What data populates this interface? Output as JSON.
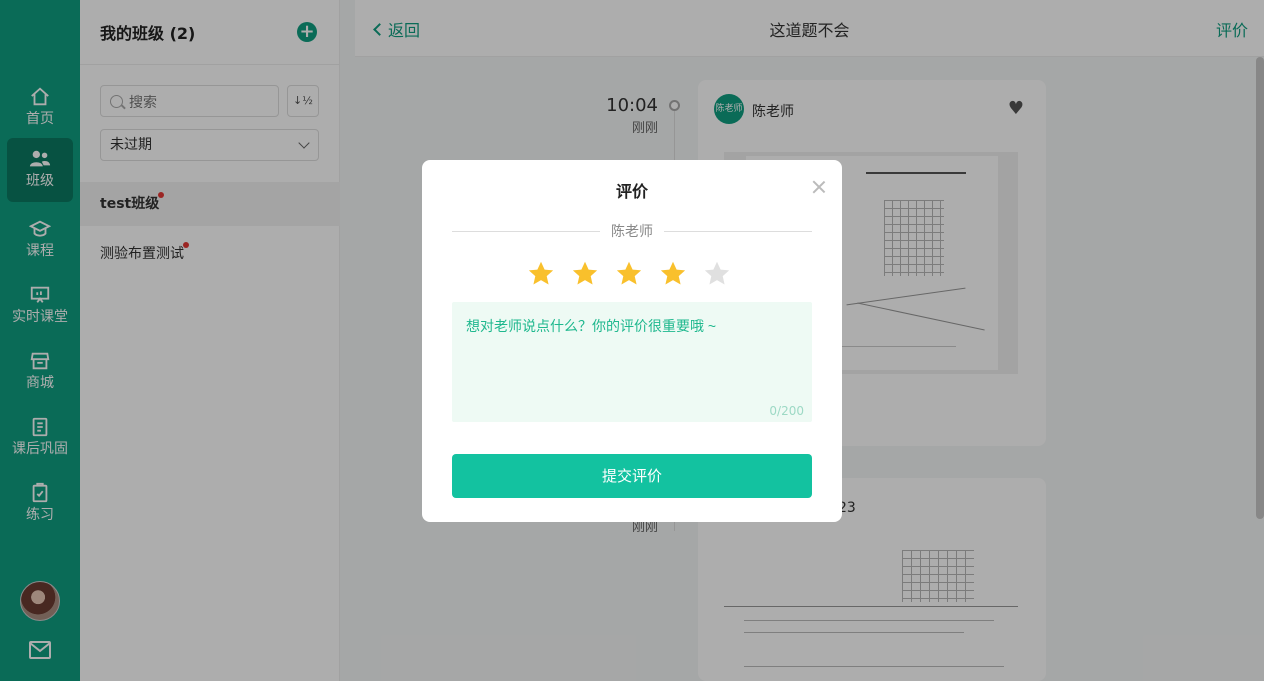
{
  "nav": {
    "items": [
      {
        "label": "首页",
        "icon": "home-icon"
      },
      {
        "label": "班级",
        "icon": "users-icon"
      },
      {
        "label": "课程",
        "icon": "graduation-cap-icon"
      },
      {
        "label": "实时课堂",
        "icon": "presentation-board-icon"
      },
      {
        "label": "商城",
        "icon": "store-icon"
      },
      {
        "label": "课后巩固",
        "icon": "notebook-icon"
      },
      {
        "label": "练习",
        "icon": "clipboard-check-icon"
      }
    ],
    "active_index": 1,
    "accent": "#0f9e80"
  },
  "class_panel": {
    "title": "我的班级 (2)",
    "search_placeholder": "搜索",
    "sort_label": "↓½",
    "filter_value": "未过期",
    "classes": [
      {
        "name": "test班级"
      },
      {
        "name": "测验布置测试"
      }
    ]
  },
  "topbar": {
    "back_label": "返回",
    "title": "这道题不会",
    "rate_label": "评价"
  },
  "timeline": {
    "time": "10:04",
    "sub": "刚刚",
    "sub2": "刚刚"
  },
  "card": {
    "teacher_avatar": "陈老师",
    "teacher_name": "陈老师",
    "second_card_text": "23"
  },
  "modal": {
    "title": "评价",
    "teacher": "陈老师",
    "rating": 4,
    "max_rating": 5,
    "star_on_color": "#f9c02c",
    "star_off_color": "#e0e0e0",
    "comment_placeholder": "想对老师说点什么？你的评价很重要哦 ~",
    "counter": "0/200",
    "submit_label": "提交评价"
  }
}
